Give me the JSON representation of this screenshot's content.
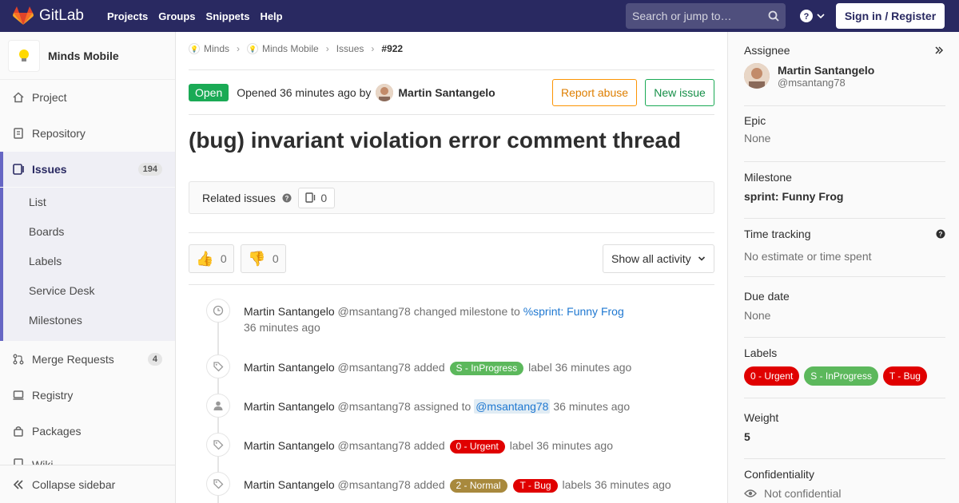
{
  "navbar": {
    "brand": "GitLab",
    "links": [
      "Projects",
      "Groups",
      "Snippets",
      "Help"
    ],
    "search_placeholder": "Search or jump to…",
    "sign_in": "Sign in / Register",
    "bg_color": "#292961"
  },
  "sidebar": {
    "project_name": "Minds Mobile",
    "items": {
      "project": "Project",
      "repository": "Repository",
      "issues": "Issues",
      "issues_count": "194",
      "merge_requests": "Merge Requests",
      "merge_requests_count": "4",
      "registry": "Registry",
      "packages": "Packages",
      "wiki": "Wiki"
    },
    "sub_items": [
      "List",
      "Boards",
      "Labels",
      "Service Desk",
      "Milestones"
    ],
    "collapse": "Collapse sidebar"
  },
  "breadcrumb": {
    "group": "Minds",
    "project": "Minds Mobile",
    "section": "Issues",
    "current": "#922"
  },
  "issue": {
    "status": "Open",
    "opened": "Opened 36 minutes ago by",
    "author": "Martin Santangelo",
    "report_abuse": "Report abuse",
    "new_issue": "New issue",
    "title": "(bug) invariant violation error comment thread",
    "related_label": "Related issues",
    "related_count": "0",
    "thumbs_up_count": "0",
    "thumbs_down_count": "0",
    "activity_filter": "Show all activity"
  },
  "timeline": [
    {
      "icon": "clock-icon",
      "user": "Martin Santangelo",
      "handle": "@msantang78",
      "action": "changed milestone to",
      "link": "%sprint: Funny Frog",
      "time": "36 minutes ago"
    },
    {
      "icon": "tag-icon",
      "user": "Martin Santangelo",
      "handle": "@msantang78",
      "action": "added",
      "labels": [
        {
          "text": "S - InProgress",
          "color": "#5cb85c"
        }
      ],
      "suffix": "label",
      "time": "36 minutes ago"
    },
    {
      "icon": "user-icon",
      "user": "Martin Santangelo",
      "handle": "@msantang78",
      "action": "assigned to",
      "mention": "@msantang78",
      "time": "36 minutes ago"
    },
    {
      "icon": "tag-icon",
      "user": "Martin Santangelo",
      "handle": "@msantang78",
      "action": "added",
      "labels": [
        {
          "text": "0 - Urgent",
          "color": "#e00000"
        }
      ],
      "suffix": "label",
      "time": "36 minutes ago"
    },
    {
      "icon": "tag-icon",
      "user": "Martin Santangelo",
      "handle": "@msantang78",
      "action": "added",
      "labels": [
        {
          "text": "2 - Normal",
          "color": "#a8893d"
        },
        {
          "text": "T - Bug",
          "color": "#e00000"
        }
      ],
      "suffix": "labels",
      "time": "36 minutes ago"
    }
  ],
  "right_sidebar": {
    "assignee_title": "Assignee",
    "assignee_name": "Martin Santangelo",
    "assignee_handle": "@msantang78",
    "epic_title": "Epic",
    "epic_value": "None",
    "milestone_title": "Milestone",
    "milestone_value": "sprint: Funny Frog",
    "time_title": "Time tracking",
    "time_value": "No estimate or time spent",
    "due_title": "Due date",
    "due_value": "None",
    "labels_title": "Labels",
    "labels": [
      {
        "text": "0 - Urgent",
        "color": "#e00000"
      },
      {
        "text": "S - InProgress",
        "color": "#5cb85c"
      },
      {
        "text": "T - Bug",
        "color": "#e00000"
      }
    ],
    "weight_title": "Weight",
    "weight_value": "5",
    "confidentiality_title": "Confidentiality",
    "confidentiality_value": "Not confidential"
  }
}
